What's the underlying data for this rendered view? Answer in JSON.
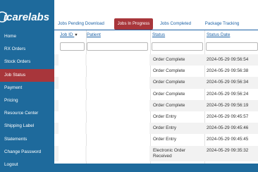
{
  "brand": {
    "logo_text": "icarelabs"
  },
  "sidebar": {
    "items": [
      {
        "label": "Home",
        "active": false
      },
      {
        "label": "RX Orders",
        "active": false
      },
      {
        "label": "Stock Orders",
        "active": false
      },
      {
        "label": "Job Status",
        "active": true
      },
      {
        "label": "Payment",
        "active": false
      },
      {
        "label": "Pricing",
        "active": false
      },
      {
        "label": "Resource Center",
        "active": false
      },
      {
        "label": "Shipping Label",
        "active": false
      },
      {
        "label": "Statements",
        "active": false
      },
      {
        "label": "Change Password",
        "active": false
      },
      {
        "label": "Logout",
        "active": false
      }
    ]
  },
  "tabs": [
    {
      "label": "Jobs Pending Download",
      "active": false
    },
    {
      "label": "Jobs In Progress",
      "active": true
    },
    {
      "label": "Jobs Completed",
      "active": false
    },
    {
      "label": "Package Tracking",
      "active": false
    }
  ],
  "table": {
    "headers": {
      "job_id": "Job ID",
      "sort_indicator": "▼",
      "patient": "Patient",
      "status": "Status",
      "status_date": "Status Date"
    },
    "rows": [
      {
        "job_id": "",
        "patient": "",
        "status": "Order Complete",
        "status_date": "2024-05-29 09:56:54"
      },
      {
        "job_id": "",
        "patient": "",
        "status": "Order Complete",
        "status_date": "2024-05-29 09:56:38"
      },
      {
        "job_id": "",
        "patient": "",
        "status": "Order Complete",
        "status_date": "2024-05-29 09:56:34"
      },
      {
        "job_id": "",
        "patient": "",
        "status": "Order Complete",
        "status_date": "2024-05-29 09:56:24"
      },
      {
        "job_id": "",
        "patient": "",
        "status": "Order Complete",
        "status_date": "2024-05-29 09:56:19"
      },
      {
        "job_id": "",
        "patient": "",
        "status": "Order Entry",
        "status_date": "2024-05-29 09:45:57"
      },
      {
        "job_id": "",
        "patient": "",
        "status": "Order Entry",
        "status_date": "2024-05-29 09:45:46"
      },
      {
        "job_id": "",
        "patient": "",
        "status": "Order Entry",
        "status_date": "2024-05-29 09:45:45"
      },
      {
        "job_id": "",
        "patient": "",
        "status": "Electronic Order Received",
        "status_date": "2024-05-29 09:35:32"
      }
    ]
  },
  "colors": {
    "sidebar": "#1e6a9c",
    "active": "#a8363b",
    "link": "#1c62a6"
  }
}
